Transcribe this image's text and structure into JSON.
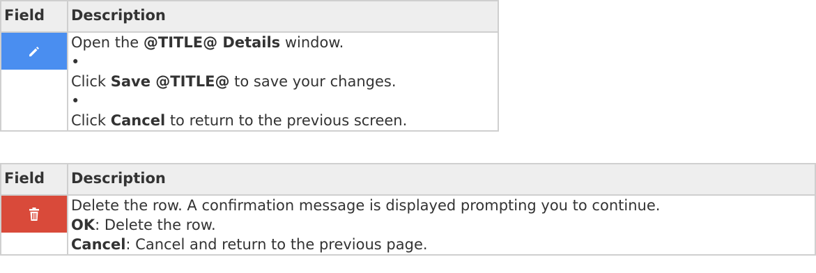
{
  "table1": {
    "header_field": "Field",
    "header_description": "Description",
    "icon": "pencil-icon",
    "lines": [
      {
        "before": "Open the ",
        "bold": "@TITLE@ Details",
        "after": " window."
      },
      {
        "bullet": "•"
      },
      {
        "before": "Click ",
        "bold": "Save @TITLE@",
        "after": " to save your changes."
      },
      {
        "bullet": "•"
      },
      {
        "before": "Click ",
        "bold": "Cancel",
        "after": " to return to the previous screen."
      }
    ]
  },
  "table2": {
    "header_field": "Field",
    "header_description": "Description",
    "icon": "trash-icon",
    "line1": "Delete the row. A confirmation message is displayed prompting you to continue.",
    "line2_bold": "OK",
    "line2_rest": ": Delete the row.",
    "line3_bold": "Cancel",
    "line3_rest": ": Cancel and return to the previous page."
  },
  "colors": {
    "edit_button": "#4a8ef0",
    "delete_button": "#d94a3a",
    "header_bg": "#eeeeee",
    "border": "#cfcfcf"
  }
}
